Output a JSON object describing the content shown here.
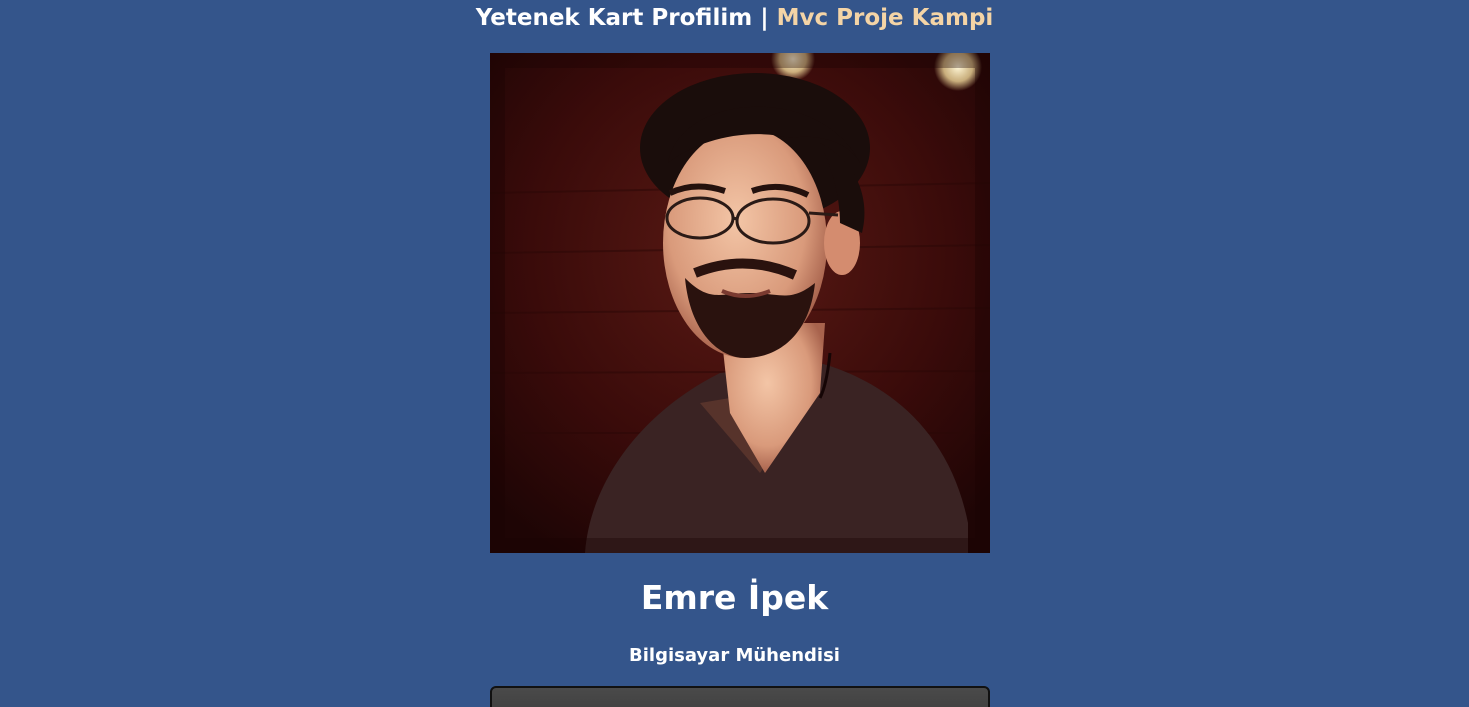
{
  "header": {
    "title_main": "Yetenek Kart Profilim",
    "separator": "|",
    "title_sub": "Mvc Proje Kampi"
  },
  "profile": {
    "photo_alt": "Emre İpek",
    "name": "Emre İpek",
    "role": "Bilgisayar Mühendisi"
  },
  "colors": {
    "background": "#34558b",
    "accent_subtitle": "#f4d4a6",
    "text": "#ffffff",
    "card": "#3f3f3f"
  }
}
